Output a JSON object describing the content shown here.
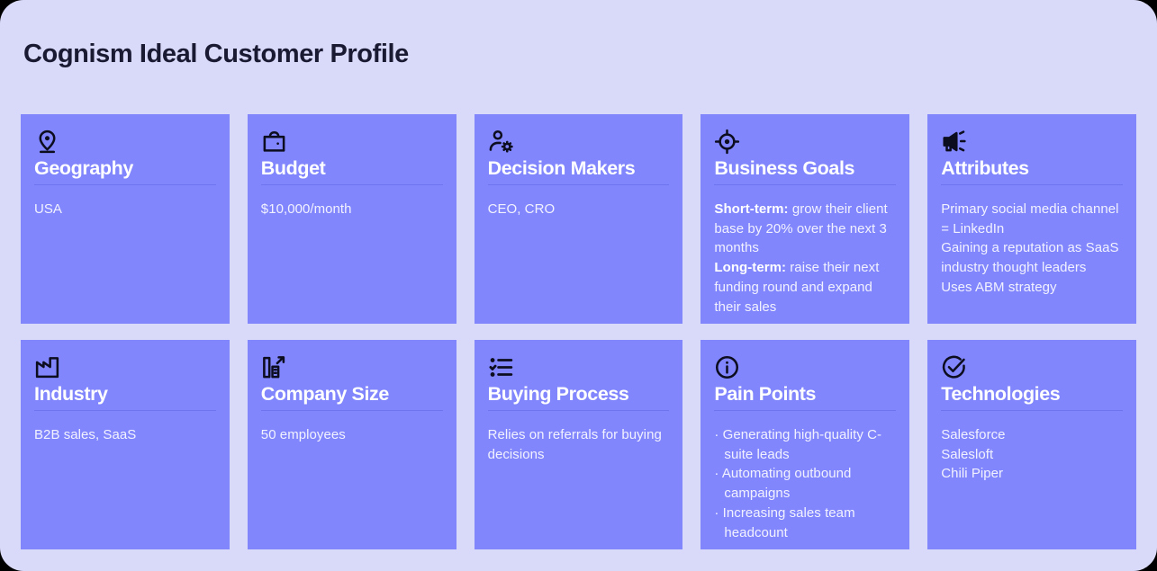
{
  "header": {
    "title": "Cognism Ideal Customer Profile"
  },
  "colors": {
    "panel_background": "#D9D9F9",
    "card_background": "#8186FC",
    "title_text": "#1A1A33",
    "card_title_text": "#FFFFFF",
    "card_divider": "#6E73EE",
    "icon": "#0D0D20",
    "outer_background": "#000000"
  },
  "cards": [
    {
      "icon": "map-pin-icon",
      "title": "Geography",
      "body_lines": [
        {
          "text": "USA"
        }
      ]
    },
    {
      "icon": "briefcase-icon",
      "title": "Budget",
      "body_lines": [
        {
          "text": "$10,000/month"
        }
      ]
    },
    {
      "icon": "user-settings-icon",
      "title": "Decision Makers",
      "body_lines": [
        {
          "text": "CEO, CRO"
        }
      ]
    },
    {
      "icon": "target-crosshair-icon",
      "title": "Business Goals",
      "body_lines": [
        {
          "label": "Short-term:",
          "text": " grow their client base by 20% over the next 3 months"
        },
        {
          "label": "Long-term:",
          "text": " raise their next funding round and expand their sales"
        }
      ]
    },
    {
      "icon": "megaphone-icon",
      "title": "Attributes",
      "body_lines": [
        {
          "text": "Primary social media channel = LinkedIn"
        },
        {
          "text": "Gaining a reputation as SaaS industry thought leaders"
        },
        {
          "text": "Uses ABM strategy"
        }
      ]
    },
    {
      "icon": "factory-icon",
      "title": "Industry",
      "body_lines": [
        {
          "text": "B2B sales, SaaS"
        }
      ]
    },
    {
      "icon": "building-growth-icon",
      "title": "Company Size",
      "body_lines": [
        {
          "text": "50 employees"
        }
      ]
    },
    {
      "icon": "checklist-icon",
      "title": "Buying Process",
      "body_lines": [
        {
          "text": "Relies on referrals for buying decisions"
        }
      ]
    },
    {
      "icon": "info-circle-icon",
      "title": "Pain Points",
      "bullet_marker": "·",
      "bullets": [
        "Generating high-quality C-suite leads",
        "Automating outbound campaigns",
        "Increasing sales team headcount"
      ]
    },
    {
      "icon": "check-circle-icon",
      "title": "Technologies",
      "body_lines": [
        {
          "text": "Salesforce"
        },
        {
          "text": "Salesloft"
        },
        {
          "text": "Chili Piper"
        }
      ]
    }
  ]
}
